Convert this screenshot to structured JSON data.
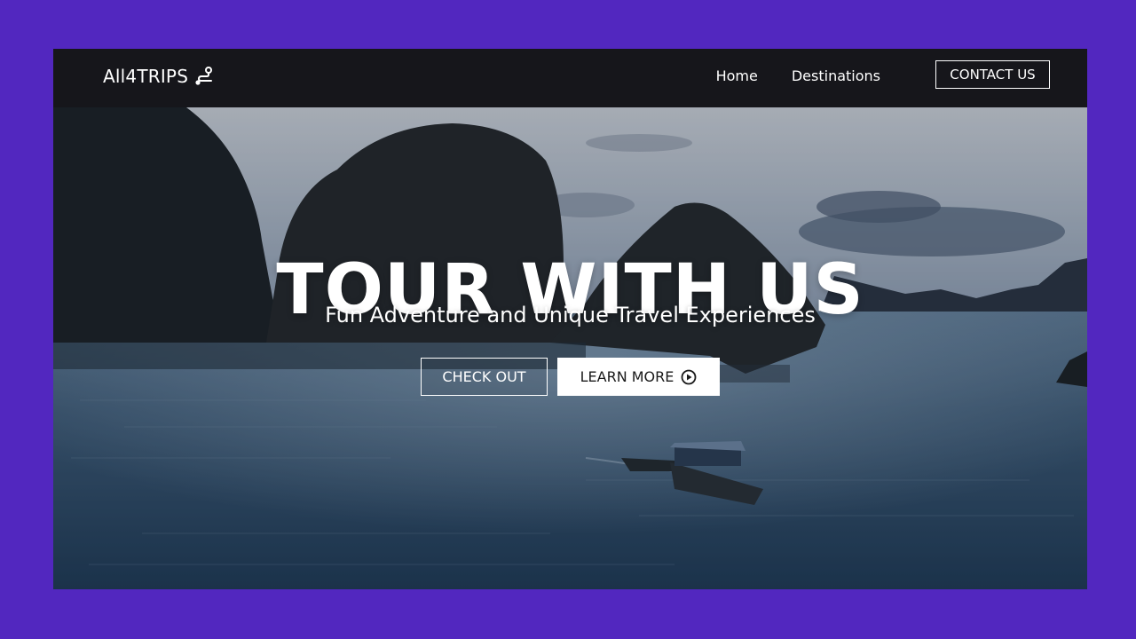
{
  "brand": {
    "name": "All4TRIPS",
    "icon": "route-icon"
  },
  "nav": {
    "links": [
      "Home",
      "Destinations"
    ],
    "contact_label": "CONTACT US"
  },
  "hero": {
    "title": "TOUR WITH US",
    "subtitle": "Fun Adventure and Unique Travel Experiences",
    "primary_cta": "CHECK OUT",
    "secondary_cta": "LEARN MORE",
    "secondary_cta_icon": "play-circle-icon"
  },
  "colors": {
    "page_background": "#5227bf",
    "navbar_background": "#16161b",
    "text": "#ffffff"
  }
}
